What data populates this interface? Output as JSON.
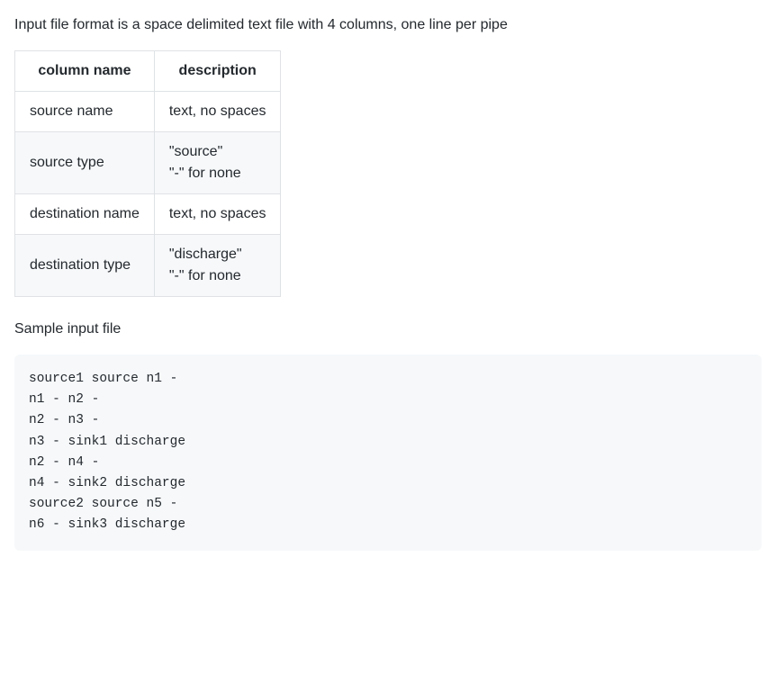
{
  "intro": "Input file format is a space delimited text file with 4 columns, one line per pipe",
  "table": {
    "headers": [
      "column name",
      "description"
    ],
    "rows": [
      {
        "name": "source name",
        "desc": [
          "text, no spaces"
        ]
      },
      {
        "name": "source type",
        "desc": [
          "\"source\"",
          "\"-\" for none"
        ]
      },
      {
        "name": "destination name",
        "desc": [
          "text, no spaces"
        ]
      },
      {
        "name": "destination type",
        "desc": [
          "\"discharge\"",
          "\"-\" for none"
        ]
      }
    ]
  },
  "sample_label": "Sample input file",
  "sample_code": "source1 source n1 -\nn1 - n2 -\nn2 - n3 -\nn3 - sink1 discharge\nn2 - n4 -\nn4 - sink2 discharge\nsource2 source n5 -\nn6 - sink3 discharge"
}
